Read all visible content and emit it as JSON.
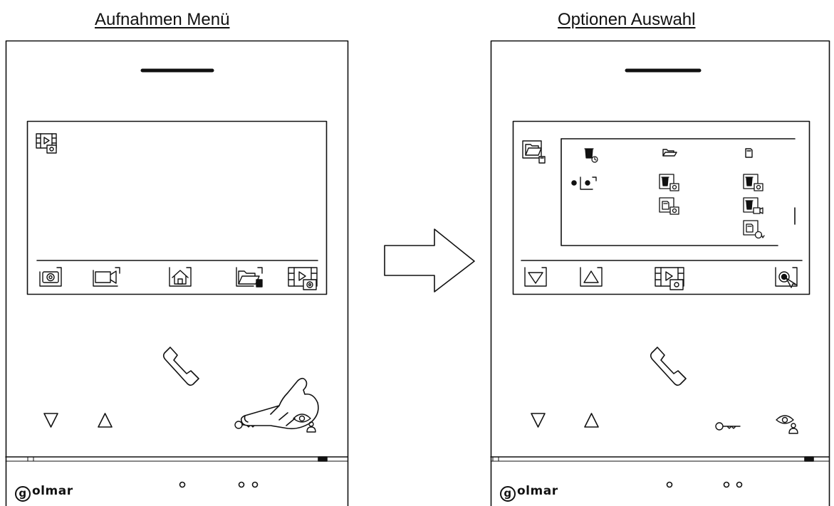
{
  "captions": {
    "left": "Aufnahmen Menü",
    "right": "Optionen Auswahl"
  },
  "brand": "golmar",
  "left_monitor": {
    "screen": {
      "top_icon": "recordings-camera-settings-icon",
      "bottom_bar": [
        "photo-camera-icon",
        "video-camera-icon",
        "home-icon",
        "folder-sd-icon",
        "video-settings-icon"
      ]
    },
    "buttons": [
      "down-triangle-icon",
      "up-triangle-icon",
      "handset-icon",
      "key-icon",
      "eye-user-icon"
    ],
    "finger_pressing": "key-button"
  },
  "right_monitor": {
    "screen": {
      "top_left_icon": "folder-sd-icon",
      "columns": [
        "trash-timer-icon",
        "folder-icon",
        "sd-card-icon"
      ],
      "rows": [
        [
          "record-dot-icon",
          "trash-photo-icon",
          "trash-photo-icon"
        ],
        [
          "",
          "sd-photo-icon",
          "trash-video-icon"
        ],
        [
          "",
          "",
          "sd-format-icon"
        ]
      ],
      "bottom_bar": [
        "down-button-icon",
        "up-button-icon",
        "video-settings-icon",
        "",
        "select-touch-icon"
      ]
    },
    "buttons": [
      "down-triangle-icon",
      "up-triangle-icon",
      "handset-icon",
      "key-icon",
      "eye-user-icon"
    ]
  },
  "transition": "right-arrow-icon"
}
